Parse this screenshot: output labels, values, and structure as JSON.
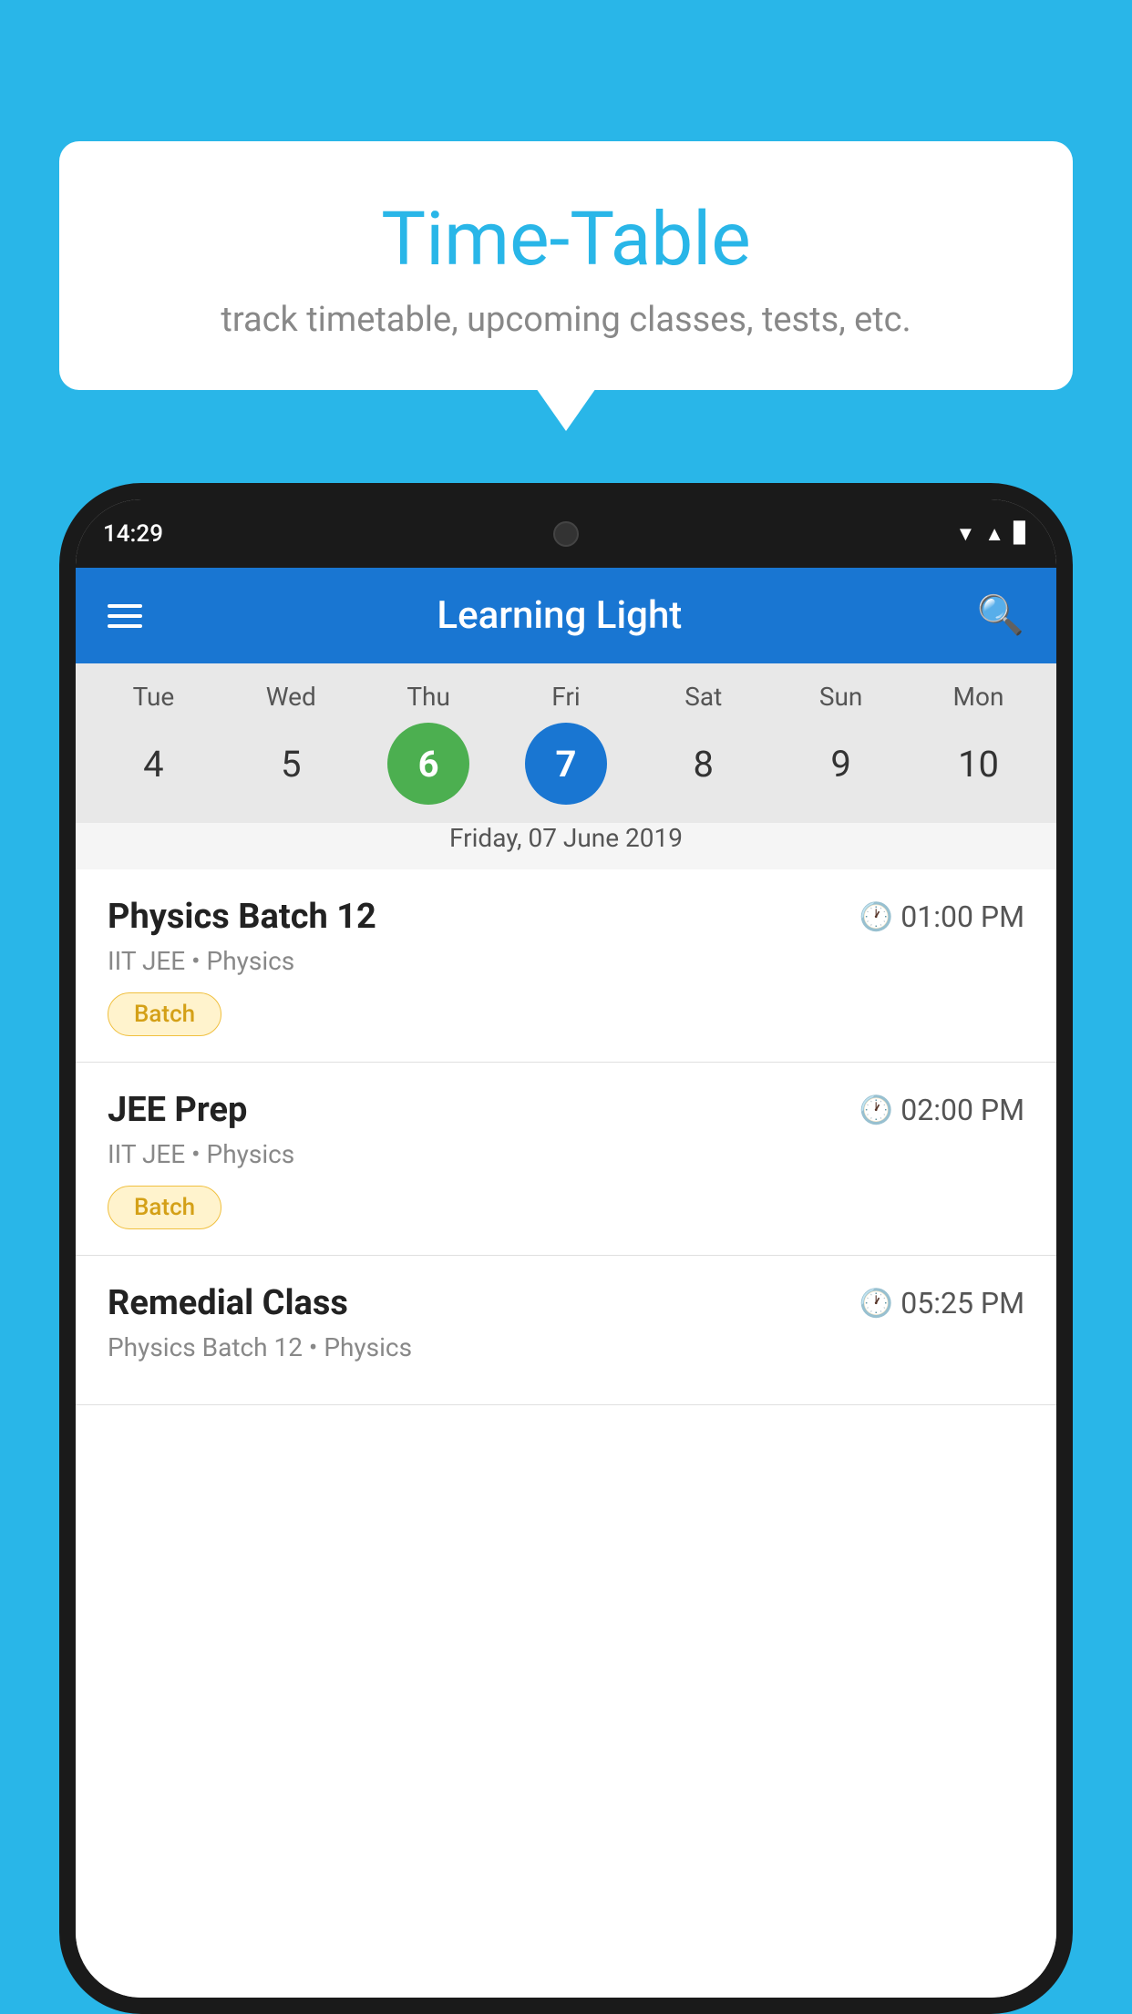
{
  "background_color": "#29B6E8",
  "bubble": {
    "title": "Time-Table",
    "subtitle": "track timetable, upcoming classes, tests, etc."
  },
  "phone": {
    "time": "14:29",
    "app_title": "Learning Light",
    "calendar": {
      "days": [
        "Tue",
        "Wed",
        "Thu",
        "Fri",
        "Sat",
        "Sun",
        "Mon"
      ],
      "dates": [
        "4",
        "5",
        "6",
        "7",
        "8",
        "9",
        "10"
      ],
      "today_index": 2,
      "selected_index": 3,
      "selected_date_label": "Friday, 07 June 2019"
    },
    "schedule": [
      {
        "title": "Physics Batch 12",
        "time": "01:00 PM",
        "subtitle": "IIT JEE • Physics",
        "badge": "Batch"
      },
      {
        "title": "JEE Prep",
        "time": "02:00 PM",
        "subtitle": "IIT JEE • Physics",
        "badge": "Batch"
      },
      {
        "title": "Remedial Class",
        "time": "05:25 PM",
        "subtitle": "Physics Batch 12 • Physics",
        "badge": ""
      }
    ]
  }
}
